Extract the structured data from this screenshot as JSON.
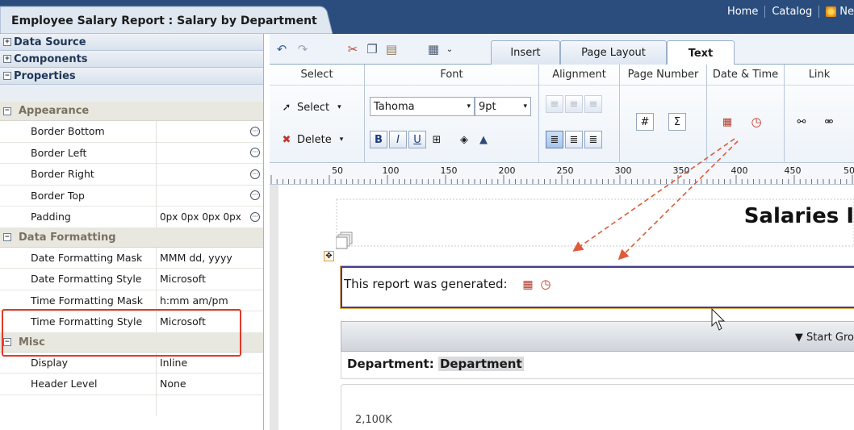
{
  "app": {
    "title": "Employee Salary Report : Salary by Department",
    "top_links": [
      "Home",
      "Catalog"
    ],
    "new_label": "Ne"
  },
  "accordion": {
    "data_source": "Data Source",
    "components": "Components",
    "properties": "Properties"
  },
  "properties": {
    "appearance": {
      "title": "Appearance",
      "rows": [
        {
          "name": "Border Bottom",
          "value": ""
        },
        {
          "name": "Border Left",
          "value": ""
        },
        {
          "name": "Border Right",
          "value": ""
        },
        {
          "name": "Border Top",
          "value": ""
        },
        {
          "name": "Padding",
          "value": "0px 0px 0px 0px"
        }
      ]
    },
    "data_formatting": {
      "title": "Data Formatting",
      "rows": [
        {
          "name": "Date Formatting Mask",
          "value": "MMM dd, yyyy"
        },
        {
          "name": "Date Formatting Style",
          "value": "Microsoft"
        },
        {
          "name": "Time Formatting Mask",
          "value": "h:mm am/pm"
        },
        {
          "name": "Time Formatting Style",
          "value": "Microsoft"
        }
      ]
    },
    "misc": {
      "title": "Misc",
      "rows": [
        {
          "name": "Display",
          "value": "Inline"
        },
        {
          "name": "Header Level",
          "value": "None"
        }
      ]
    }
  },
  "ribbon": {
    "tabs": [
      "Insert",
      "Page Layout",
      "Text"
    ],
    "active_tab": "Text",
    "groups": {
      "select": "Select",
      "font": "Font",
      "alignment": "Alignment",
      "page_number": "Page Number",
      "date_time": "Date & Time",
      "link": "Link"
    },
    "select_label": "Select",
    "delete_label": "Delete",
    "font_name": "Tahoma",
    "font_size": "9pt"
  },
  "ruler": {
    "ticks": [
      "50",
      "100",
      "150",
      "200",
      "250",
      "300",
      "350",
      "400",
      "450",
      "50"
    ]
  },
  "canvas": {
    "report_title": "Salaries I",
    "generated_text": "This report was generated:",
    "group_bar_text": "▼ Start Gro",
    "dept_label": "Department:",
    "dept_field": "Department",
    "chart_tick": "2,100K"
  },
  "colors": {
    "titlebar": "#2a4d7e",
    "highlight": "#e03a2a",
    "arrows": "#e05a3a"
  }
}
